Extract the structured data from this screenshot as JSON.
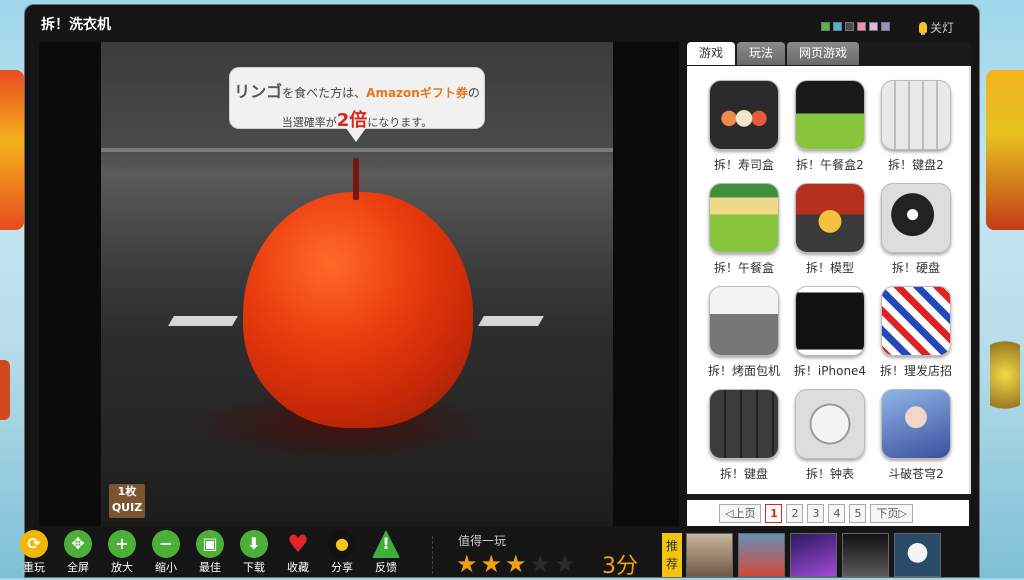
{
  "window": {
    "title": "拆！洗衣机",
    "lights_label": "关灯",
    "swatch_colors": [
      "#4dbb4d",
      "#47b6d8",
      "#4a4a4a",
      "#f58ea8",
      "#e3b6e3",
      "#8f8fd6"
    ]
  },
  "game": {
    "bubble": {
      "line1_big": "リンゴ",
      "line1_a": "を食べた方は、",
      "line1_orange": "Amazonギフト券",
      "line1_b": "の",
      "line2_a": "当選確率が",
      "line2_red": "2倍",
      "line2_b": "になります。"
    },
    "quiz_badge": {
      "line1": "1枚",
      "line2": "QUIZ"
    }
  },
  "side": {
    "tabs": [
      "游戏",
      "玩法",
      "网页游戏"
    ],
    "games": [
      {
        "label": "拆！寿司盒",
        "icon": "sushi-box-icon"
      },
      {
        "label": "拆！午餐盒2",
        "icon": "lunch-box2-icon"
      },
      {
        "label": "拆！键盘2",
        "icon": "keyboard2-icon"
      },
      {
        "label": "拆！午餐盒",
        "icon": "lunch-box-icon"
      },
      {
        "label": "拆！模型",
        "icon": "model-icon"
      },
      {
        "label": "拆！硬盘",
        "icon": "hard-disk-icon"
      },
      {
        "label": "拆！烤面包机",
        "icon": "toaster-icon"
      },
      {
        "label": "拆！iPhone4",
        "icon": "iphone4-icon"
      },
      {
        "label": "拆！理发店招",
        "icon": "barber-pole-icon"
      },
      {
        "label": "拆！键盘",
        "icon": "keyboard-icon"
      },
      {
        "label": "拆！钟表",
        "icon": "clock-icon"
      },
      {
        "label": "斗破苍穹2",
        "icon": "fantasy-game-icon"
      }
    ],
    "pager": {
      "prev": "上页",
      "pages": [
        "1",
        "2",
        "3",
        "4",
        "5"
      ],
      "current": "1",
      "next": "下页"
    }
  },
  "toolbar": {
    "tools": [
      {
        "label": "重玩",
        "icon": "replay-icon",
        "color": "#f2b705"
      },
      {
        "label": "全屏",
        "icon": "fullscreen-icon",
        "color": "#4caf3a"
      },
      {
        "label": "放大",
        "icon": "zoom-in-icon",
        "color": "#4caf3a"
      },
      {
        "label": "缩小",
        "icon": "zoom-out-icon",
        "color": "#4caf3a"
      },
      {
        "label": "最佳",
        "icon": "best-fit-icon",
        "color": "#4caf3a"
      },
      {
        "label": "下载",
        "icon": "download-icon",
        "color": "#4caf3a"
      },
      {
        "label": "收藏",
        "icon": "favorite-icon",
        "color": "#e0242a"
      },
      {
        "label": "分享",
        "icon": "qq-share-icon",
        "color": "#222222"
      },
      {
        "label": "反馈",
        "icon": "feedback-icon",
        "color": "#3fae3a"
      }
    ],
    "rating": {
      "label": "值得一玩",
      "stars_filled": 3,
      "stars_total": 5,
      "score": "3分"
    },
    "recommend": {
      "label": "推荐",
      "count": 5
    }
  }
}
